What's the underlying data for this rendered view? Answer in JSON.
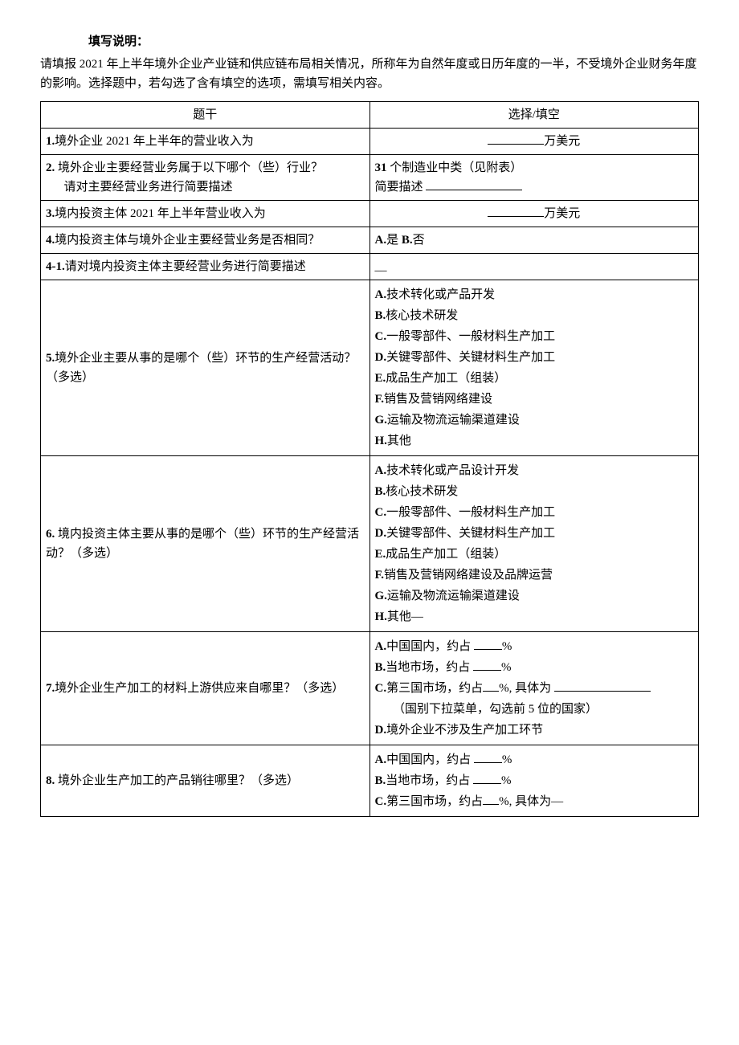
{
  "instructions": {
    "label": "填写说明：",
    "text": "请填报 2021 年上半年境外企业产业链和供应链布局相关情况，所称年为自然年度或日历年度的一半，不受境外企业财务年度的影响。选择题中，若勾选了含有填空的选项，需填写相关内容。"
  },
  "table": {
    "header": {
      "col1": "题干",
      "col2": "选择/填空"
    },
    "q1": {
      "stem_prefix": "1.",
      "stem": "境外企业 2021 年上半年的营业收入为",
      "unit": "万美元"
    },
    "q2": {
      "stem_prefix": "2.",
      "stem_line1": " 境外企业主要经营业务属于以下哪个（些）行业？",
      "stem_line2": "请对主要经营业务进行简要描述",
      "ans_line1_prefix": "31",
      "ans_line1_rest": " 个制造业中类（见附表）",
      "ans_line2_label": "简要描述 "
    },
    "q3": {
      "stem_prefix": "3.",
      "stem": "境内投资主体 2021 年上半年营业收入为",
      "unit": "万美元"
    },
    "q4": {
      "stem_prefix": "4.",
      "stem": "境内投资主体与境外企业主要经营业务是否相同？",
      "optA_prefix": "A.",
      "optA": "是 ",
      "optB_prefix": "B.",
      "optB": "否"
    },
    "q4_1": {
      "stem_prefix": "4-1.",
      "stem": "请对境内投资主体主要经营业务进行简要描述",
      "ans": "__"
    },
    "q5": {
      "stem_prefix": "5.",
      "stem": "境外企业主要从事的是哪个（些）环节的生产经营活动？（多选）",
      "A_p": "A.",
      "A": "技术转化或产品开发",
      "B_p": "B.",
      "B": "核心技术研发",
      "C_p": "C.",
      "C": "一般零部件、一般材料生产加工",
      "D_p": "D.",
      "D": "关键零部件、关键材料生产加工",
      "E_p": "E.",
      "E": "成品生产加工（组装）",
      "F_p": "F.",
      "F": "销售及营销网络建设",
      "G_p": "G.",
      "G": "运输及物流运输渠道建设",
      "H_p": "H.",
      "H": "其他"
    },
    "q6": {
      "stem_prefix": "6.",
      "stem": " 境内投资主体主要从事的是哪个（些）环节的生产经营活动？（多选）",
      "A_p": "A.",
      "A": "技术转化或产品设计开发",
      "B_p": "B.",
      "B": "核心技术研发",
      "C_p": "C.",
      "C": "一般零部件、一般材料生产加工",
      "D_p": "D.",
      "D": "关键零部件、关键材料生产加工",
      "E_p": "E.",
      "E": "成品生产加工（组装）",
      "F_p": "F.",
      "F": "销售及营销网络建设及品牌运营",
      "G_p": "G.",
      "G": "运输及物流运输渠道建设",
      "H_p": "H.",
      "H": "其他―"
    },
    "q7": {
      "stem_prefix": "7.",
      "stem": "境外企业生产加工的材料上游供应来自哪里？（多选）",
      "A_p": "A.",
      "A_pre": "中国国内，约占 ",
      "A_suf": "%",
      "B_p": "B.",
      "B_pre": "当地市场，约占 ",
      "B_suf": "%",
      "C_p": "C.",
      "C_pre": "第三国市场，约占",
      "C_mid": "%, 具体为 ",
      "C_note": "（国别下拉菜单，勾选前 5 位的国家）",
      "D_p": "D.",
      "D": "境外企业不涉及生产加工环节"
    },
    "q8": {
      "stem_prefix": "8.",
      "stem": " 境外企业生产加工的产品销往哪里？（多选）",
      "A_p": "A.",
      "A_pre": "中国国内，约占 ",
      "A_suf": "%",
      "B_p": "B.",
      "B_pre": "当地市场，约占 ",
      "B_suf": "%",
      "C_p": "C.",
      "C_pre": "第三国市场，约占",
      "C_suf": "%, 具体为―"
    }
  }
}
